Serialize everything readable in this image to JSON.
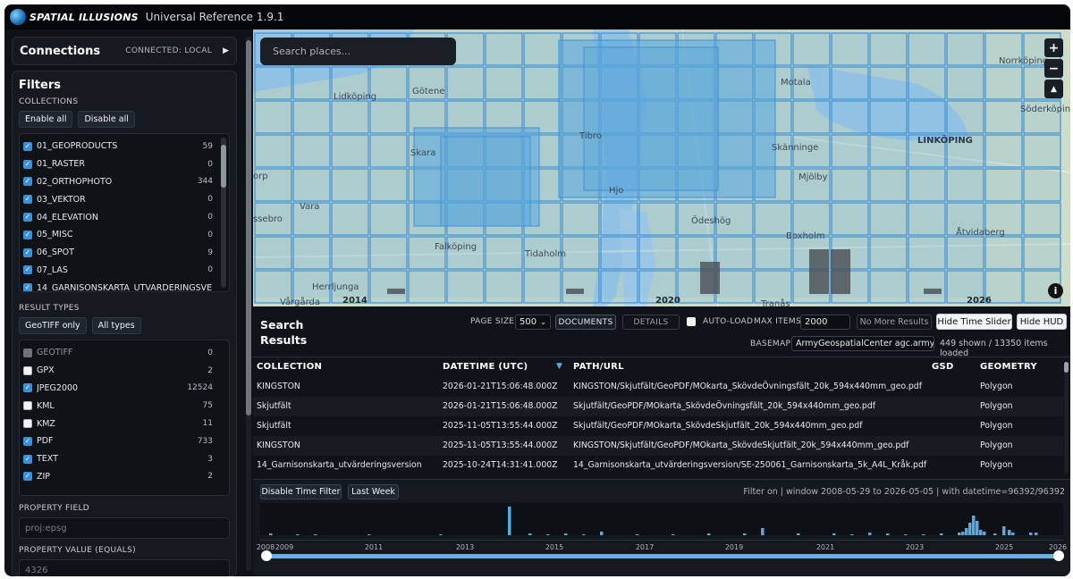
{
  "title_bar": {
    "brand": "SPATIAL ILLUSIONS",
    "app": "Universal Reference 1.9.1"
  },
  "connections": {
    "title": "Connections",
    "status": "CONNECTED: LOCAL",
    "arrow": "▶"
  },
  "filters": {
    "title": "Filters",
    "collections_label": "COLLECTIONS",
    "enable_all": "Enable all",
    "disable_all": "Disable all",
    "collections": [
      {
        "name": "01_GEOPRODUCTS",
        "count": "59",
        "checked": true
      },
      {
        "name": "01_RASTER",
        "count": "0",
        "checked": true
      },
      {
        "name": "02_ORTHOPHOTO",
        "count": "344",
        "checked": true
      },
      {
        "name": "03_VEKTOR",
        "count": "0",
        "checked": true
      },
      {
        "name": "04_ELEVATION",
        "count": "0",
        "checked": true
      },
      {
        "name": "05_MISC",
        "count": "0",
        "checked": true
      },
      {
        "name": "06_SPOT",
        "count": "9",
        "checked": true
      },
      {
        "name": "07_LAS",
        "count": "0",
        "checked": true
      },
      {
        "name": "14_GARNISONSKARTA_UTVÄRDERINGSVERSI",
        "count": "",
        "checked": true
      }
    ],
    "result_types_label": "RESULT TYPES",
    "geotiff_only": "GeoTIFF only",
    "all_types": "All types",
    "result_types": [
      {
        "name": "GEOTIFF",
        "count": "0",
        "state": "dis"
      },
      {
        "name": "GPX",
        "count": "2",
        "state": "off"
      },
      {
        "name": "JPEG2000",
        "count": "12524",
        "state": "on"
      },
      {
        "name": "KML",
        "count": "75",
        "state": "off"
      },
      {
        "name": "KMZ",
        "count": "11",
        "state": "off"
      },
      {
        "name": "PDF",
        "count": "733",
        "state": "on"
      },
      {
        "name": "TEXT",
        "count": "3",
        "state": "on"
      },
      {
        "name": "ZIP",
        "count": "2",
        "state": "on"
      }
    ],
    "property_field_label": "PROPERTY FIELD",
    "property_field_placeholder": "proj:epsg",
    "property_value_label": "PROPERTY VALUE (EQUALS)",
    "property_value_placeholder": "4326"
  },
  "map": {
    "search_placeholder": "Search places...",
    "zoom_in": "+",
    "zoom_out": "−",
    "compass": "▲",
    "info": "i",
    "labels": {
      "norrkoping": "Norrköping",
      "soderkoping": "Söderköping",
      "motala": "Motala",
      "linkoping": "LINKÖPING",
      "skanninge": "Skänninge",
      "mjolby": "Mjölby",
      "lidkoping": "Lidköping",
      "gotene": "Götene",
      "skara": "Skara",
      "vara": "Vara",
      "tibro": "Tibro",
      "hjo": "Hjo",
      "odeshog": "Ödeshög",
      "boxholm": "Boxholm",
      "atvidaberg": "Åtvidaberg",
      "falkoping": "Falköping",
      "tidaholm": "Tidaholm",
      "herrljunga": "Herrljunga",
      "vargarda": "Vårgårda",
      "tranas": "Tranås",
      "essebro": "ssebro",
      "torp": "orp"
    },
    "overlay_years": [
      "2014",
      "2020",
      "2026"
    ]
  },
  "results": {
    "title": "Search Results",
    "page_size_label": "PAGE SIZE",
    "page_size": "500",
    "documents": "DOCUMENTS",
    "details": "DETAILS",
    "auto_load": "AUTO-LOAD",
    "max_items_label": "MAX ITEMS",
    "max_items": "2000",
    "no_more": "No More Results",
    "hide_time_slider": "Hide Time Slider",
    "hide_hud": "Hide HUD",
    "basemap_label": "BASEMAP",
    "basemap": "ArmyGeospatialCenter agc.army.mi",
    "summary": "449 shown / 13350 items loaded",
    "columns": [
      "COLLECTION",
      "DATETIME (UTC)",
      "▼",
      "PATH/URL",
      "GSD",
      "GEOMETRY"
    ],
    "rows": [
      [
        "KINGSTON",
        "2026-01-21T15:06:48.000Z",
        "KINGSTON/Skjutfält/GeoPDF/MOkarta_SkövdeÖvningsfält_20k_594x440mm_geo.pdf",
        "",
        "Polygon"
      ],
      [
        "Skjutfält",
        "2026-01-21T15:06:48.000Z",
        "Skjutfält/GeoPDF/MOkarta_SkövdeÖvningsfält_20k_594x440mm_geo.pdf",
        "",
        "Polygon"
      ],
      [
        "Skjutfält",
        "2025-11-05T13:55:44.000Z",
        "Skjutfält/GeoPDF/MOkarta_SkövdeSkjutfält_20k_594x440mm_geo.pdf",
        "",
        "Polygon"
      ],
      [
        "KINGSTON",
        "2025-11-05T13:55:44.000Z",
        "KINGSTON/Skjutfält/GeoPDF/MOkarta_SkövdeSkjutfält_20k_594x440mm_geo.pdf",
        "",
        "Polygon"
      ],
      [
        "14_Garnisonskarta_utvärderingsversion",
        "2025-10-24T14:31:41.000Z",
        "14_Garnisonskarta_utvärderingsversion/SE-250061_Garnisonskarta_5k_A4L_Kråk.pdf",
        "",
        "Polygon"
      ]
    ]
  },
  "timeline": {
    "disable_time_filter": "Disable Time Filter",
    "last_week": "Last Week",
    "filter_info": "Filter on | window 2008-05-29 to 2026-05-05 | with datetime=96392/96392",
    "years": [
      "2008",
      "2009",
      "2011",
      "2013",
      "2015",
      "2017",
      "2019",
      "2021",
      "2023",
      "2025",
      "2026"
    ],
    "histogram_color": "#5aa7dc"
  },
  "colors": {
    "accent": "#3a8fd9",
    "coverage_fill": "#5aa7dc",
    "coverage_stroke": "#3d8fd0"
  }
}
